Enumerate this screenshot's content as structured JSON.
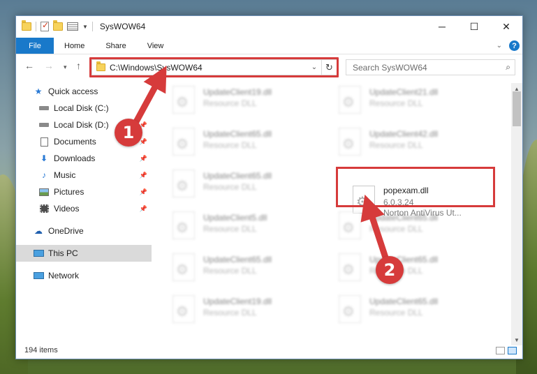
{
  "window": {
    "title": "SysWOW64",
    "controls": {
      "minimize": "─",
      "maximize": "☐",
      "close": "✕"
    }
  },
  "ribbon": {
    "tabs": [
      "File",
      "Home",
      "Share",
      "View"
    ],
    "help": "?"
  },
  "nav": {
    "address": "C:\\Windows\\SysWOW64",
    "search_placeholder": "Search SysWOW64"
  },
  "sidebar": {
    "items": [
      {
        "label": "Quick access",
        "icon": "star-icon"
      },
      {
        "label": "Local Disk (C:)",
        "icon": "drive-icon",
        "pinned": true
      },
      {
        "label": "Local Disk (D:)",
        "icon": "drive-icon",
        "pinned": true
      },
      {
        "label": "Documents",
        "icon": "documents-icon",
        "pinned": true
      },
      {
        "label": "Downloads",
        "icon": "downloads-icon",
        "pinned": true
      },
      {
        "label": "Music",
        "icon": "music-icon",
        "pinned": true
      },
      {
        "label": "Pictures",
        "icon": "pictures-icon",
        "pinned": true
      },
      {
        "label": "Videos",
        "icon": "videos-icon",
        "pinned": true
      },
      {
        "label": "OneDrive",
        "icon": "cloud-icon"
      },
      {
        "label": "This PC",
        "icon": "computer-icon",
        "selected": true
      },
      {
        "label": "Network",
        "icon": "network-icon"
      }
    ]
  },
  "files": [
    {
      "name": "UpdateClient19.dll",
      "sub1": "Resource DLL",
      "blurred": true
    },
    {
      "name": "UpdateClient21.dll",
      "sub1": "Resource DLL",
      "blurred": true
    },
    {
      "name": "UpdateClient65.dll",
      "sub1": "Resource DLL",
      "blurred": true
    },
    {
      "name": "UpdateClient42.dll",
      "sub1": "Resource DLL",
      "blurred": true
    },
    {
      "name": "UpdateClient65.dll",
      "sub1": "Resource DLL",
      "blurred": true
    },
    {
      "name": "popexam.dll",
      "sub1": "6.0.3.24",
      "sub2": "Norton AntiVirus Ut...",
      "blurred": false
    },
    {
      "name": "UpdateClient5.dll",
      "sub1": "Resource DLL",
      "blurred": true
    },
    {
      "name": "UpdateClient65.dll",
      "sub1": "Resource DLL",
      "blurred": true
    },
    {
      "name": "UpdateClient65.dll",
      "sub1": "Resource DLL",
      "blurred": true
    },
    {
      "name": "UpdateClient65.dll",
      "sub1": "Resource DLL",
      "blurred": true
    },
    {
      "name": "UpdateClient19.dll",
      "sub1": "Resource DLL",
      "blurred": true
    },
    {
      "name": "UpdateClient65.dll",
      "sub1": "Resource DLL",
      "blurred": true
    }
  ],
  "status": {
    "item_count": "194 items"
  },
  "callouts": [
    "1",
    "2"
  ],
  "colors": {
    "accent": "#1979ca",
    "highlight": "#d63b3b"
  }
}
